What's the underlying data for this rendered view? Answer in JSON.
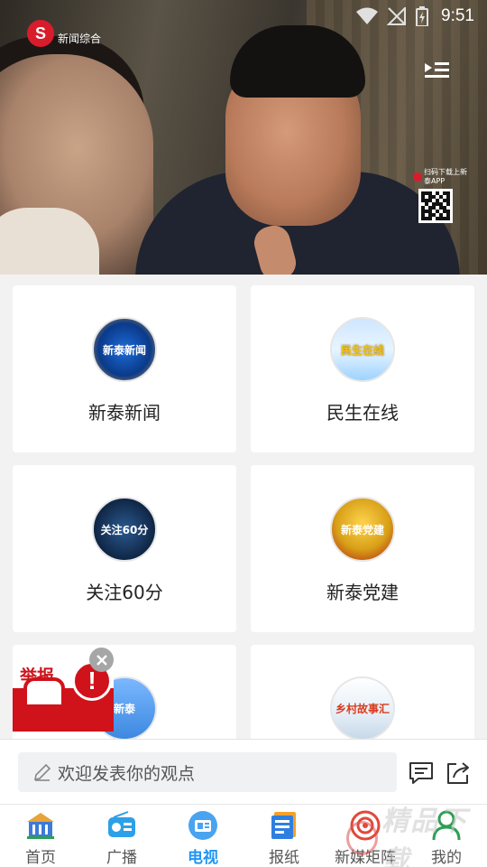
{
  "status_bar": {
    "time": "9:51"
  },
  "player": {
    "channel_name": "新闻综合",
    "qr_caption": "扫码下载上新泰APP"
  },
  "programs": [
    {
      "label": "新泰新闻",
      "thumb_text": "新泰新闻",
      "icon": "program-thumbnail"
    },
    {
      "label": "民生在线",
      "thumb_text": "民生在线",
      "icon": "program-thumbnail"
    },
    {
      "label": "关注60分",
      "thumb_text": "关注60分",
      "icon": "program-thumbnail"
    },
    {
      "label": "新泰党建",
      "thumb_text": "新泰党建",
      "icon": "program-thumbnail"
    },
    {
      "label": "",
      "thumb_text": "新泰",
      "icon": "program-thumbnail"
    },
    {
      "label": "",
      "thumb_text": "乡村故事汇",
      "icon": "program-thumbnail"
    }
  ],
  "report_ad": {
    "text": "举报",
    "mark": "!"
  },
  "comment": {
    "placeholder": "欢迎发表你的观点"
  },
  "nav": [
    {
      "label": "首页",
      "icon": "home-icon",
      "active": false
    },
    {
      "label": "广播",
      "icon": "radio-icon",
      "active": false
    },
    {
      "label": "电视",
      "icon": "tv-icon",
      "active": true
    },
    {
      "label": "报纸",
      "icon": "newspaper-icon",
      "active": false
    },
    {
      "label": "新媒矩阵",
      "icon": "media-matrix-icon",
      "active": false
    },
    {
      "label": "我的",
      "icon": "profile-icon",
      "active": false
    }
  ],
  "watermark": "精品下载",
  "colors": {
    "accent": "#2196f3",
    "brand_red": "#d91c2c"
  }
}
